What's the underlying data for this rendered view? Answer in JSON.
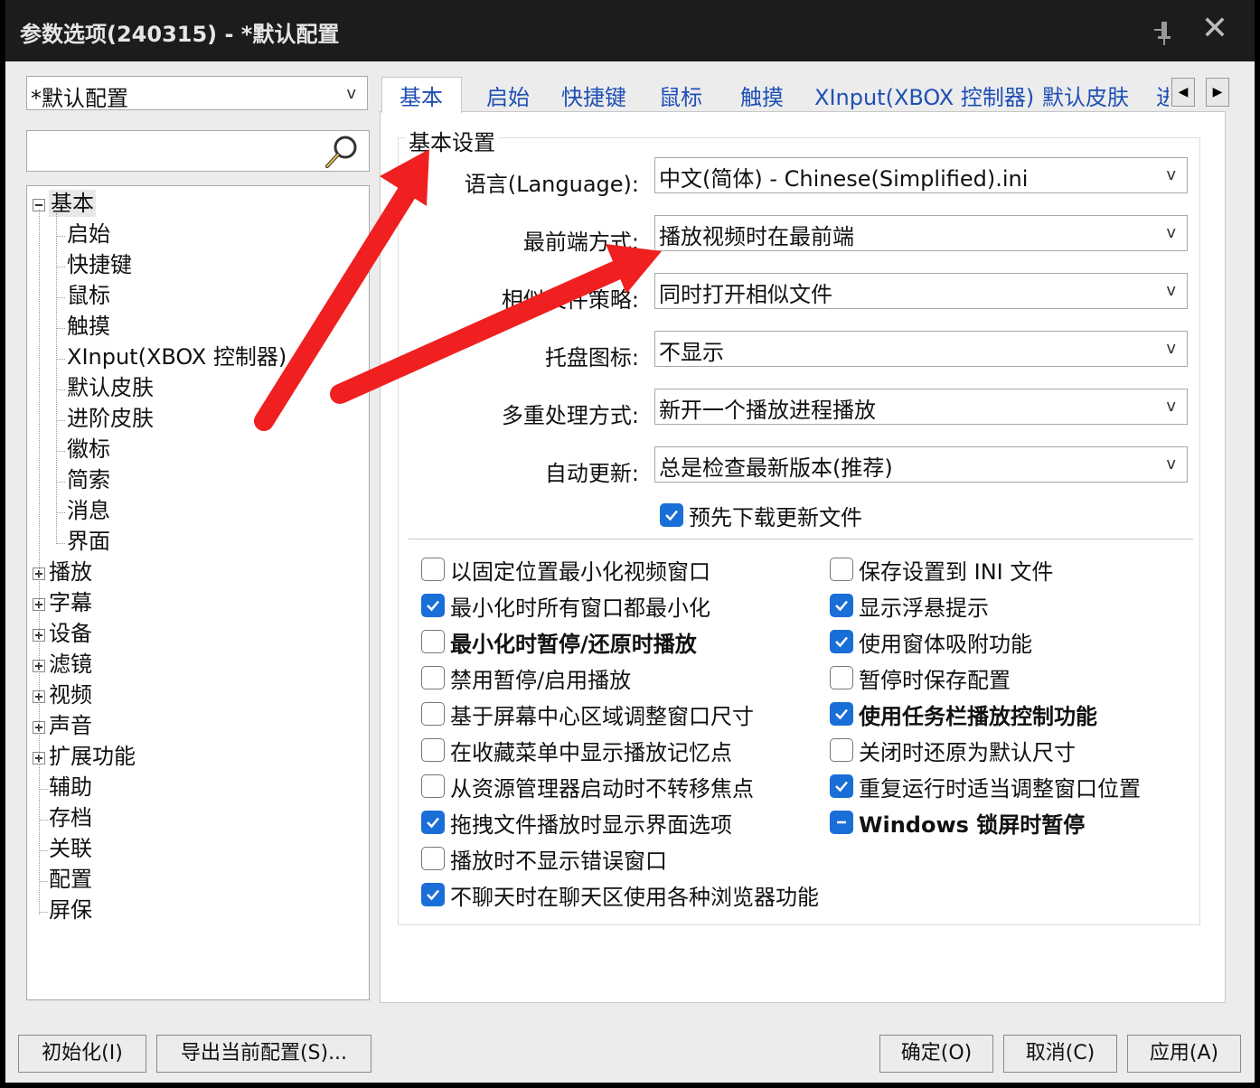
{
  "window": {
    "title": "参数选项(240315) - *默认配置"
  },
  "profile": {
    "value": "*默认配置",
    "chevron": "v"
  },
  "search": {
    "value": ""
  },
  "tree": {
    "root_label": "基本",
    "children": [
      "启始",
      "快捷键",
      "鼠标",
      "触摸",
      "XInput(XBOX 控制器)",
      "默认皮肤",
      "进阶皮肤",
      "徽标",
      "简索",
      "消息",
      "界面"
    ],
    "collapsed": [
      "播放",
      "字幕",
      "设备",
      "滤镜",
      "视频",
      "声音",
      "扩展功能"
    ],
    "leaves": [
      "辅助",
      "存档",
      "关联",
      "配置",
      "屏保"
    ]
  },
  "tabs": {
    "items": [
      "基本",
      "启始",
      "快捷键",
      "鼠标",
      "触摸",
      "XInput(XBOX 控制器)",
      "默认皮肤",
      "进"
    ],
    "scroll_left": "◀",
    "scroll_right": "▶"
  },
  "basic": {
    "group_title": "基本设置",
    "fields": [
      {
        "label": "语言(Language):",
        "value": "中文(简体) - Chinese(Simplified).ini"
      },
      {
        "label": "最前端方式:",
        "value": "播放视频时在最前端"
      },
      {
        "label": "相似文件策略:",
        "value": "同时打开相似文件"
      },
      {
        "label": "托盘图标:",
        "value": "不显示"
      },
      {
        "label": "多重处理方式:",
        "value": "新开一个播放进程播放"
      },
      {
        "label": "自动更新:",
        "value": "总是检查最新版本(推荐)"
      }
    ],
    "chevron": "v",
    "predownload": "预先下载更新文件",
    "left_options": [
      "以固定位置最小化视频窗口",
      "最小化时所有窗口都最小化",
      "最小化时暂停/还原时播放",
      "禁用暂停/启用播放",
      "基于屏幕中心区域调整窗口尺寸",
      "在收藏菜单中显示播放记忆点",
      "从资源管理器启动时不转移焦点",
      "拖拽文件播放时显示界面选项",
      "播放时不显示错误窗口",
      "不聊天时在聊天区使用各种浏览器功能"
    ],
    "right_options": [
      "保存设置到 INI 文件",
      "显示浮悬提示",
      "使用窗体吸附功能",
      "暂停时保存配置",
      "使用任务栏播放控制功能",
      "关闭时还原为默认尺寸",
      "重复运行时适当调整窗口位置",
      "Windows 锁屏时暂停"
    ]
  },
  "buttons": {
    "init": "初始化(I)",
    "export": "导出当前配置(S)...",
    "ok": "确定(O)",
    "cancel": "取消(C)",
    "apply": "应用(A)"
  },
  "colors": {
    "accent": "#1a6ed8",
    "titlebar": "#1c1c1c",
    "tab_text": "#1f4fb5",
    "annotation": "#f02020"
  }
}
